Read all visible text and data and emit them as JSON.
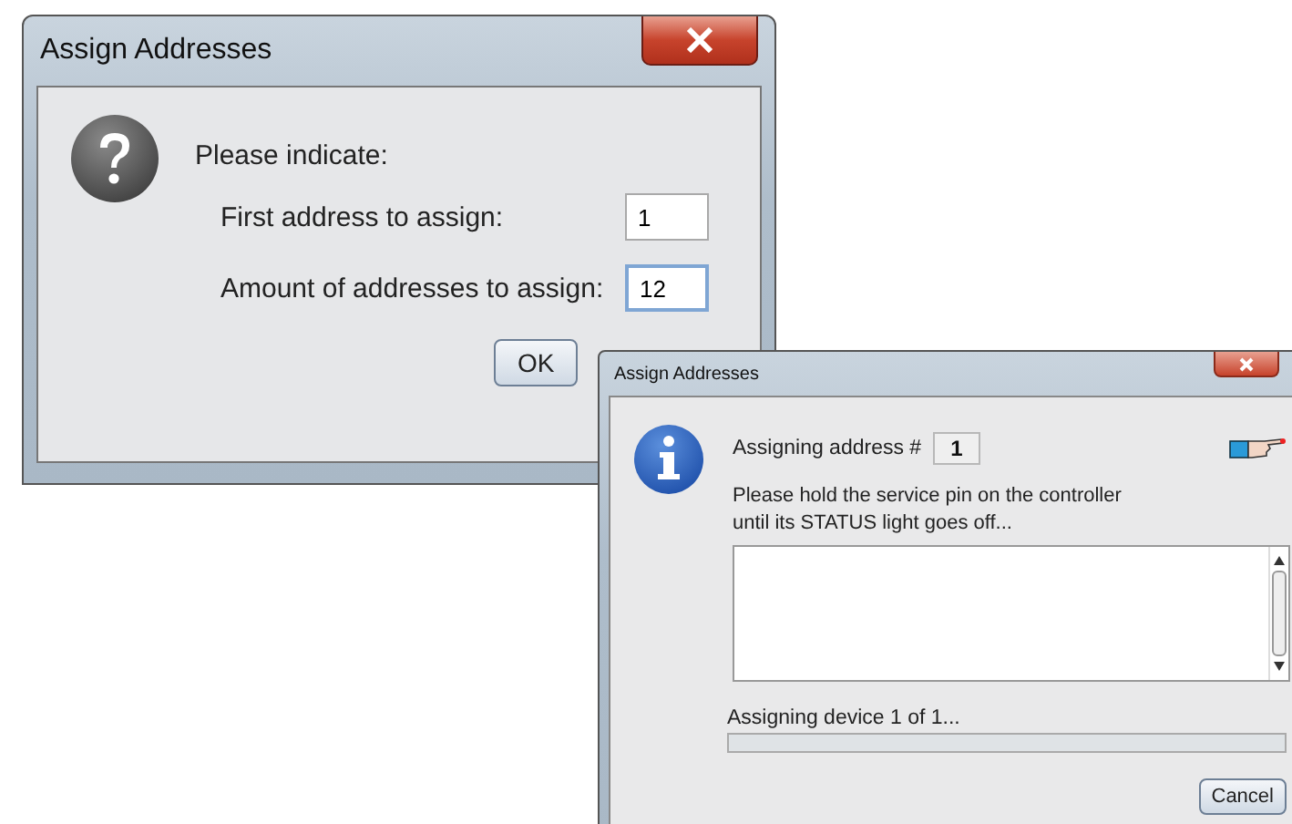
{
  "dialog_1": {
    "title": "Assign Addresses",
    "prompt": "Please indicate:",
    "fields": [
      {
        "label": "First address to assign:",
        "value": "1",
        "focused": false
      },
      {
        "label": "Amount of addresses to assign:",
        "value": "12",
        "focused": true
      }
    ],
    "buttons": [
      "OK"
    ]
  },
  "dialog_2": {
    "title": "Assign Addresses",
    "address_label": "Assigning address #",
    "address_value": "1",
    "message_lines": [
      "Please hold the service pin on the controller",
      "until its STATUS light goes off..."
    ],
    "progress_label": "Assigning device 1 of 1...",
    "progress": {
      "level": 0
    },
    "buttons": [
      "Cancel"
    ]
  }
}
